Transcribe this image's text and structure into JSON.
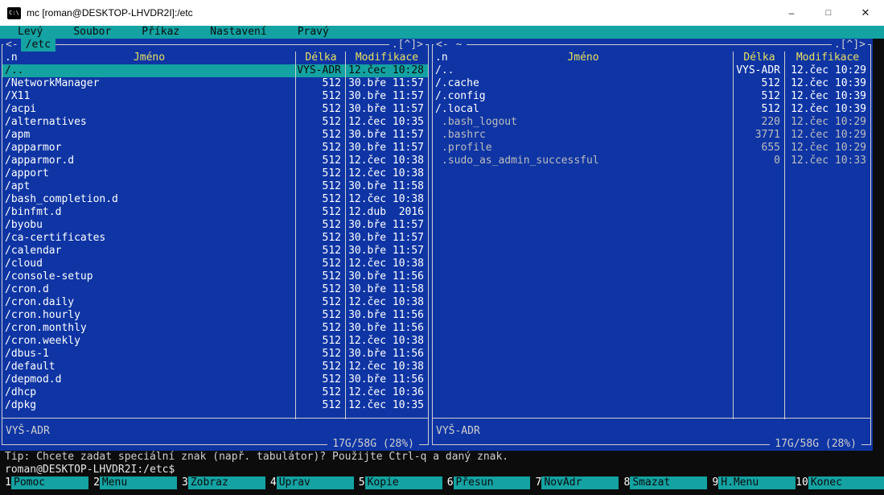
{
  "window": {
    "title": "mc [roman@DESKTOP-LHVDR2I]:/etc",
    "icon_glyph": "C:\\",
    "controls": {
      "minimize": "–",
      "maximize": "□",
      "close": "✕"
    }
  },
  "palette": {
    "panel_blue": "#0f35a4",
    "cyan_accent": "#14a2a2",
    "header_yellow": "#e8e060",
    "terminal_black": "#0c0c0c",
    "frame_white": "#cfcfcf"
  },
  "menu": {
    "items": [
      "Levý",
      "Soubor",
      "Příkaz",
      "Nastavení",
      "Pravý"
    ]
  },
  "left_panel": {
    "nav_left": "<-",
    "path": "/etc",
    "nav_right": ".[^]>",
    "sort_indicator": ".n",
    "columns": {
      "name": "Jméno",
      "size": "Délka",
      "mtime": "Modifikace"
    },
    "rows": [
      {
        "name": "/..",
        "size": "VYŠ-ADR",
        "mtime": "12.čec 10:28",
        "type": "dir",
        "selected": true
      },
      {
        "name": "/NetworkManager",
        "size": "512",
        "mtime": "30.bře 11:57",
        "type": "dir"
      },
      {
        "name": "/X11",
        "size": "512",
        "mtime": "30.bře 11:57",
        "type": "dir"
      },
      {
        "name": "/acpi",
        "size": "512",
        "mtime": "30.bře 11:57",
        "type": "dir"
      },
      {
        "name": "/alternatives",
        "size": "512",
        "mtime": "12.čec 10:35",
        "type": "dir"
      },
      {
        "name": "/apm",
        "size": "512",
        "mtime": "30.bře 11:57",
        "type": "dir"
      },
      {
        "name": "/apparmor",
        "size": "512",
        "mtime": "30.bře 11:57",
        "type": "dir"
      },
      {
        "name": "/apparmor.d",
        "size": "512",
        "mtime": "12.čec 10:38",
        "type": "dir"
      },
      {
        "name": "/apport",
        "size": "512",
        "mtime": "12.čec 10:38",
        "type": "dir"
      },
      {
        "name": "/apt",
        "size": "512",
        "mtime": "30.bře 11:58",
        "type": "dir"
      },
      {
        "name": "/bash_completion.d",
        "size": "512",
        "mtime": "12.čec 10:38",
        "type": "dir"
      },
      {
        "name": "/binfmt.d",
        "size": "512",
        "mtime": "12.dub  2016",
        "type": "dir"
      },
      {
        "name": "/byobu",
        "size": "512",
        "mtime": "30.bře 11:57",
        "type": "dir"
      },
      {
        "name": "/ca-certificates",
        "size": "512",
        "mtime": "30.bře 11:57",
        "type": "dir"
      },
      {
        "name": "/calendar",
        "size": "512",
        "mtime": "30.bře 11:57",
        "type": "dir"
      },
      {
        "name": "/cloud",
        "size": "512",
        "mtime": "12.čec 10:38",
        "type": "dir"
      },
      {
        "name": "/console-setup",
        "size": "512",
        "mtime": "30.bře 11:56",
        "type": "dir"
      },
      {
        "name": "/cron.d",
        "size": "512",
        "mtime": "30.bře 11:58",
        "type": "dir"
      },
      {
        "name": "/cron.daily",
        "size": "512",
        "mtime": "12.čec 10:38",
        "type": "dir"
      },
      {
        "name": "/cron.hourly",
        "size": "512",
        "mtime": "30.bře 11:56",
        "type": "dir"
      },
      {
        "name": "/cron.monthly",
        "size": "512",
        "mtime": "30.bře 11:56",
        "type": "dir"
      },
      {
        "name": "/cron.weekly",
        "size": "512",
        "mtime": "12.čec 10:38",
        "type": "dir"
      },
      {
        "name": "/dbus-1",
        "size": "512",
        "mtime": "30.bře 11:56",
        "type": "dir"
      },
      {
        "name": "/default",
        "size": "512",
        "mtime": "12.čec 10:38",
        "type": "dir"
      },
      {
        "name": "/depmod.d",
        "size": "512",
        "mtime": "30.bře 11:56",
        "type": "dir"
      },
      {
        "name": "/dhcp",
        "size": "512",
        "mtime": "12.čec 10:36",
        "type": "dir"
      },
      {
        "name": "/dpkg",
        "size": "512",
        "mtime": "12.čec 10:35",
        "type": "dir"
      }
    ],
    "mini_status": "VYŠ-ADR",
    "free_space": "17G/58G (28%)"
  },
  "right_panel": {
    "nav_left": "<-",
    "path": "~",
    "nav_right": ".[^]>",
    "sort_indicator": ".n",
    "columns": {
      "name": "Jméno",
      "size": "Délka",
      "mtime": "Modifikace"
    },
    "rows": [
      {
        "name": "/..",
        "size": "VYŠ-ADR",
        "mtime": "12.čec 10:29",
        "type": "dir"
      },
      {
        "name": "/.cache",
        "size": "512",
        "mtime": "12.čec 10:39",
        "type": "dir"
      },
      {
        "name": "/.config",
        "size": "512",
        "mtime": "12.čec 10:39",
        "type": "dir"
      },
      {
        "name": "/.local",
        "size": "512",
        "mtime": "12.čec 10:39",
        "type": "dir"
      },
      {
        "name": ".bash_logout",
        "size": "220",
        "mtime": "12.čec 10:29",
        "type": "file"
      },
      {
        "name": ".bashrc",
        "size": "3771",
        "mtime": "12.čec 10:29",
        "type": "file"
      },
      {
        "name": ".profile",
        "size": "655",
        "mtime": "12.čec 10:29",
        "type": "file"
      },
      {
        "name": ".sudo_as_admin_successful",
        "size": "0",
        "mtime": "12.čec 10:33",
        "type": "file"
      }
    ],
    "mini_status": "VYŠ-ADR",
    "free_space": "17G/58G (28%)"
  },
  "hint": "Tip: Chcete zadat speciální znak (např. tabulátor)? Použijte Ctrl-q a daný znak.",
  "prompt": "roman@DESKTOP-LHVDR2I:/etc$",
  "keybar": [
    {
      "num": "1",
      "label": "Pomoc"
    },
    {
      "num": "2",
      "label": "Menu"
    },
    {
      "num": "3",
      "label": "Zobraz"
    },
    {
      "num": "4",
      "label": "Uprav"
    },
    {
      "num": "5",
      "label": "Kopie"
    },
    {
      "num": "6",
      "label": "Přesun"
    },
    {
      "num": "7",
      "label": "NovAdr"
    },
    {
      "num": "8",
      "label": "Smazat"
    },
    {
      "num": "9",
      "label": "H.Menu"
    },
    {
      "num": "10",
      "label": "Konec"
    }
  ]
}
